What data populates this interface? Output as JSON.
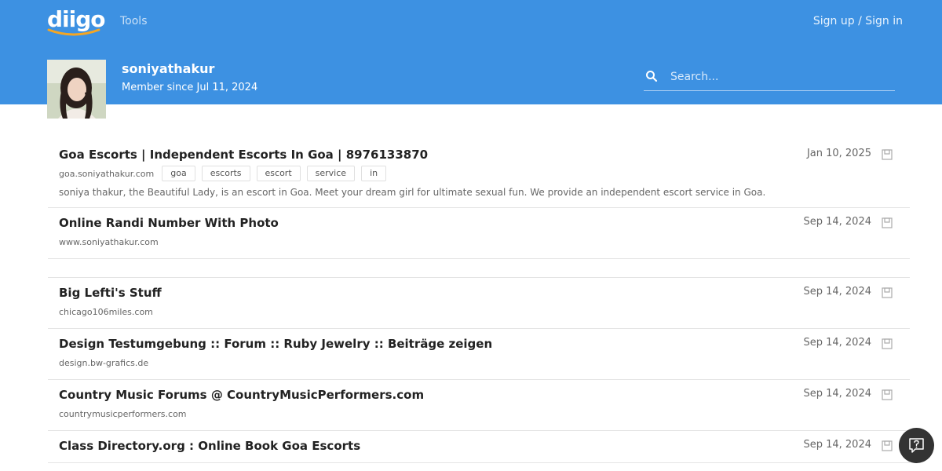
{
  "header": {
    "logo_text": "diigo",
    "tools_label": "Tools",
    "signin_label": "Sign up / Sign in"
  },
  "profile": {
    "username": "soniyathakur",
    "member_since": "Member since Jul 11, 2024"
  },
  "search": {
    "placeholder": "Search..."
  },
  "bookmarks": [
    {
      "title": "Goa Escorts | Independent Escorts In Goa | 8976133870",
      "domain": "goa.soniyathakur.com",
      "tags": [
        "goa",
        "escorts",
        "escort",
        "service",
        "in"
      ],
      "description": "soniya thakur, the Beautiful Lady, is an escort in Goa. Meet your dream girl for ultimate sexual fun. We provide an independent escort service in Goa.",
      "date": "Jan 10, 2025"
    },
    {
      "title": "Online Randi Number With Photo",
      "domain": "www.soniyathakur.com",
      "date": "Sep 14, 2024"
    },
    {
      "title": "Big Lefti's Stuff",
      "domain": "chicago106miles.com",
      "date": "Sep 14, 2024"
    },
    {
      "title": "Design Testumgebung :: Forum :: Ruby Jewelry :: Beiträge zeigen",
      "domain": "design.bw-grafics.de",
      "date": "Sep 14, 2024"
    },
    {
      "title": "Country Music Forums @ CountryMusicPerformers.com",
      "domain": "countrymusicperformers.com",
      "date": "Sep 14, 2024"
    },
    {
      "title": "Class Directory.org : Online Book Goa Escorts",
      "date": "Sep 14, 2024"
    }
  ],
  "icons": {
    "search": "search-icon",
    "bookmark": "bookmark-icon",
    "help": "help-chat-icon"
  },
  "colors": {
    "header_bg": "#3d91e2",
    "help_bg": "#333333"
  }
}
